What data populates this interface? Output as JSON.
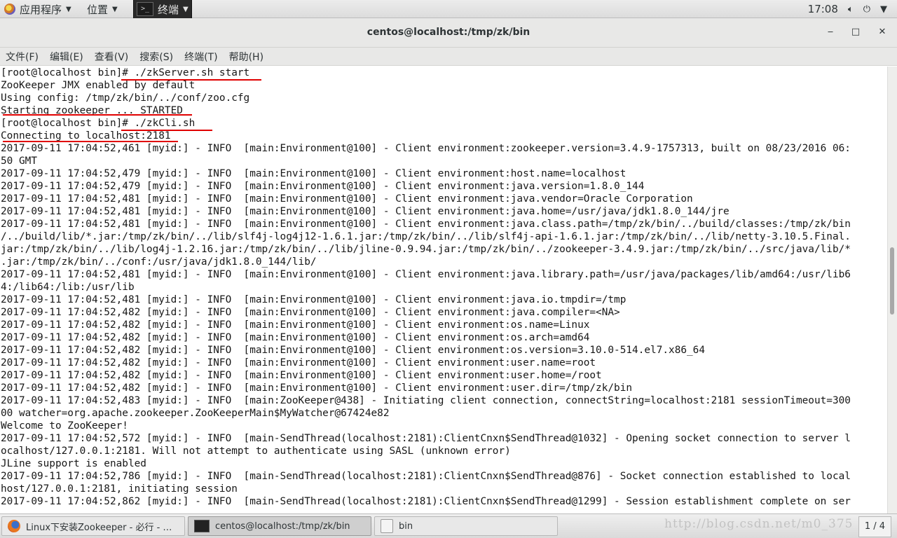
{
  "top_panel": {
    "apps_label": "应用程序",
    "places_label": "位置",
    "terminal_label": "终端",
    "clock": "17:08"
  },
  "window": {
    "title": "centos@localhost:/tmp/zk/bin",
    "minimize": "‒",
    "maximize": "□",
    "close": "✕"
  },
  "menubar": [
    "文件(F)",
    "编辑(E)",
    "查看(V)",
    "搜索(S)",
    "终端(T)",
    "帮助(H)"
  ],
  "terminal_lines": [
    "[root@localhost bin]# ./zkServer.sh start",
    "ZooKeeper JMX enabled by default",
    "Using config: /tmp/zk/bin/../conf/zoo.cfg",
    "Starting zookeeper ... STARTED",
    "[root@localhost bin]# ./zkCli.sh",
    "Connecting to localhost:2181",
    "2017-09-11 17:04:52,461 [myid:] - INFO  [main:Environment@100] - Client environment:zookeeper.version=3.4.9-1757313, built on 08/23/2016 06:",
    "50 GMT",
    "2017-09-11 17:04:52,479 [myid:] - INFO  [main:Environment@100] - Client environment:host.name=localhost",
    "2017-09-11 17:04:52,479 [myid:] - INFO  [main:Environment@100] - Client environment:java.version=1.8.0_144",
    "2017-09-11 17:04:52,481 [myid:] - INFO  [main:Environment@100] - Client environment:java.vendor=Oracle Corporation",
    "2017-09-11 17:04:52,481 [myid:] - INFO  [main:Environment@100] - Client environment:java.home=/usr/java/jdk1.8.0_144/jre",
    "2017-09-11 17:04:52,481 [myid:] - INFO  [main:Environment@100] - Client environment:java.class.path=/tmp/zk/bin/../build/classes:/tmp/zk/bin",
    "/../build/lib/*.jar:/tmp/zk/bin/../lib/slf4j-log4j12-1.6.1.jar:/tmp/zk/bin/../lib/slf4j-api-1.6.1.jar:/tmp/zk/bin/../lib/netty-3.10.5.Final.",
    "jar:/tmp/zk/bin/../lib/log4j-1.2.16.jar:/tmp/zk/bin/../lib/jline-0.9.94.jar:/tmp/zk/bin/../zookeeper-3.4.9.jar:/tmp/zk/bin/../src/java/lib/*",
    ".jar:/tmp/zk/bin/../conf:/usr/java/jdk1.8.0_144/lib/",
    "2017-09-11 17:04:52,481 [myid:] - INFO  [main:Environment@100] - Client environment:java.library.path=/usr/java/packages/lib/amd64:/usr/lib6",
    "4:/lib64:/lib:/usr/lib",
    "2017-09-11 17:04:52,481 [myid:] - INFO  [main:Environment@100] - Client environment:java.io.tmpdir=/tmp",
    "2017-09-11 17:04:52,482 [myid:] - INFO  [main:Environment@100] - Client environment:java.compiler=<NA>",
    "2017-09-11 17:04:52,482 [myid:] - INFO  [main:Environment@100] - Client environment:os.name=Linux",
    "2017-09-11 17:04:52,482 [myid:] - INFO  [main:Environment@100] - Client environment:os.arch=amd64",
    "2017-09-11 17:04:52,482 [myid:] - INFO  [main:Environment@100] - Client environment:os.version=3.10.0-514.el7.x86_64",
    "2017-09-11 17:04:52,482 [myid:] - INFO  [main:Environment@100] - Client environment:user.name=root",
    "2017-09-11 17:04:52,482 [myid:] - INFO  [main:Environment@100] - Client environment:user.home=/root",
    "2017-09-11 17:04:52,482 [myid:] - INFO  [main:Environment@100] - Client environment:user.dir=/tmp/zk/bin",
    "2017-09-11 17:04:52,483 [myid:] - INFO  [main:ZooKeeper@438] - Initiating client connection, connectString=localhost:2181 sessionTimeout=300",
    "00 watcher=org.apache.zookeeper.ZooKeeperMain$MyWatcher@67424e82",
    "Welcome to ZooKeeper!",
    "2017-09-11 17:04:52,572 [myid:] - INFO  [main-SendThread(localhost:2181):ClientCnxn$SendThread@1032] - Opening socket connection to server l",
    "ocalhost/127.0.0.1:2181. Will not attempt to authenticate using SASL (unknown error)",
    "JLine support is enabled",
    "2017-09-11 17:04:52,786 [myid:] - INFO  [main-SendThread(localhost:2181):ClientCnxn$SendThread@876] - Socket connection established to local",
    "host/127.0.0.1:2181, initiating session",
    "2017-09-11 17:04:52,862 [myid:] - INFO  [main-SendThread(localhost:2181):ClientCnxn$SendThread@1299] - Session establishment complete on ser"
  ],
  "taskbar": {
    "items": [
      "Linux下安装Zookeeper - 必行 - …",
      "centos@localhost:/tmp/zk/bin",
      "bin"
    ],
    "workspace": "1 / 4"
  },
  "watermark": "http://blog.csdn.net/m0_375"
}
